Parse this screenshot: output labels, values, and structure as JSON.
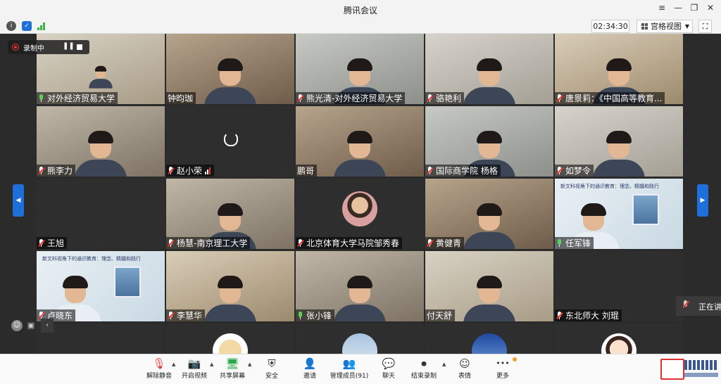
{
  "window": {
    "title": "腾讯会议",
    "controls": {
      "menu": "≡",
      "minimize": "—",
      "restore": "❐",
      "close": "✕"
    }
  },
  "infobar": {
    "timer": "02:34:30",
    "view_mode": "宫格视图",
    "fullscreen_glyph": "⛶"
  },
  "recording": {
    "label": "录制中"
  },
  "tiles": [
    {
      "name": "对外经济贸易大学",
      "mic": "on",
      "kind": "room"
    },
    {
      "name": "钟昀珈",
      "mic": "none",
      "kind": "cam"
    },
    {
      "name": "熊光清-对外经济贸易大学",
      "mic": "muted",
      "kind": "cam"
    },
    {
      "name": "骆艳利",
      "mic": "muted",
      "kind": "cam"
    },
    {
      "name": "唐景莉：《中国高等教育...",
      "mic": "muted",
      "kind": "cam"
    },
    {
      "name": "熊李力",
      "mic": "muted",
      "kind": "cam"
    },
    {
      "name": "赵小荣",
      "mic": "muted",
      "kind": "loading"
    },
    {
      "name": "鹏哥",
      "mic": "none",
      "kind": "cam"
    },
    {
      "name": "国际商学院 杨格",
      "mic": "muted",
      "kind": "cam"
    },
    {
      "name": "如梦令",
      "mic": "muted",
      "kind": "cam"
    },
    {
      "name": "王旭",
      "mic": "muted",
      "kind": "empty"
    },
    {
      "name": "杨慧-南京理工大学",
      "mic": "muted",
      "kind": "cam"
    },
    {
      "name": "北京体育大学马院邹秀春",
      "mic": "muted",
      "kind": "avatar"
    },
    {
      "name": "黄健青",
      "mic": "muted",
      "kind": "cam"
    },
    {
      "name": "任军锋",
      "mic": "on",
      "kind": "slide"
    },
    {
      "name": "卢晓东",
      "mic": "muted",
      "kind": "slide"
    },
    {
      "name": "李慧华",
      "mic": "muted",
      "kind": "cam"
    },
    {
      "name": "张小锋",
      "mic": "on",
      "kind": "cam"
    },
    {
      "name": "付天舒",
      "mic": "none",
      "kind": "cam"
    },
    {
      "name": "东北师大 刘琨",
      "mic": "muted",
      "kind": "empty"
    },
    {
      "name": "",
      "mic": "none",
      "kind": "empty"
    },
    {
      "name": "",
      "mic": "none",
      "kind": "avatar-cat"
    },
    {
      "name": "",
      "mic": "none",
      "kind": "avatar-plane"
    },
    {
      "name": "",
      "mic": "none",
      "kind": "avatar-sky"
    },
    {
      "name": "",
      "mic": "none",
      "kind": "avatar-cartoon"
    }
  ],
  "slides": {
    "text": "新文科视角下的通识教育：理念、精髓和践行"
  },
  "speaking": {
    "label": "正在讲"
  },
  "toolbar": {
    "items": [
      {
        "label": "解除静音",
        "icon": "mic-muted-icon",
        "glyph": "🎙"
      },
      {
        "label": "开启视频",
        "icon": "camera-off-icon",
        "glyph": "📷"
      },
      {
        "label": "共享屏幕",
        "icon": "share-screen-icon",
        "glyph": "🖥"
      },
      {
        "label": "安全",
        "icon": "shield-icon",
        "glyph": "⛨"
      },
      {
        "label": "邀请",
        "icon": "invite-icon",
        "glyph": "👤"
      },
      {
        "label": "管理成员(91)",
        "icon": "members-icon",
        "glyph": "👥"
      },
      {
        "label": "聊天",
        "icon": "chat-icon",
        "glyph": "💬"
      },
      {
        "label": "结束录制",
        "icon": "stop-record-icon",
        "glyph": "⏺"
      },
      {
        "label": "表情",
        "icon": "emoji-icon",
        "glyph": "☺"
      },
      {
        "label": "更多",
        "icon": "more-icon",
        "glyph": "•••"
      }
    ]
  },
  "colors": {
    "accent": "#1e6fd9",
    "record_red": "#e33333",
    "mic_on": "#5cd05c"
  }
}
